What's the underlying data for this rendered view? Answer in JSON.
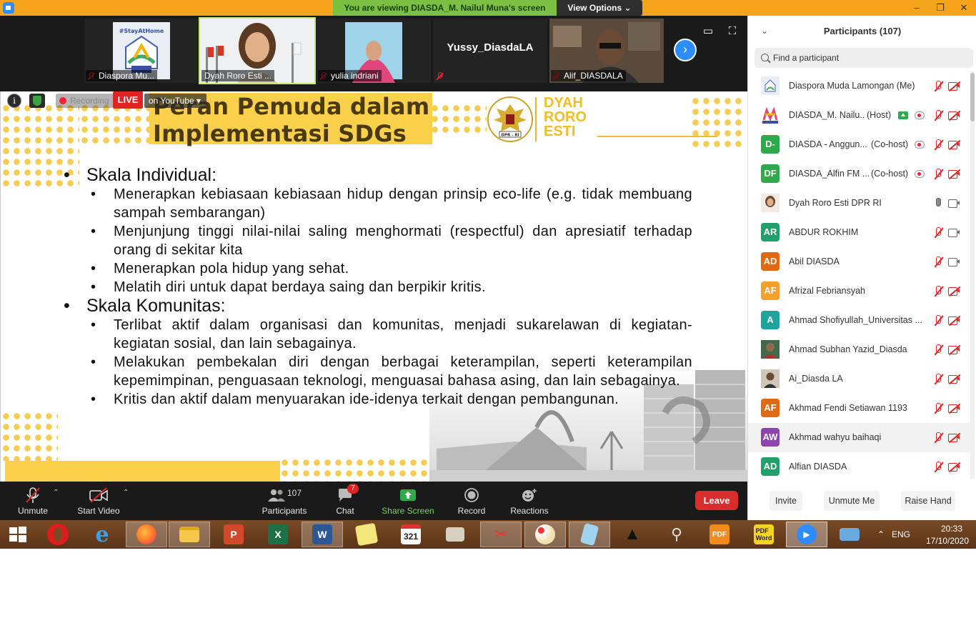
{
  "topbar": {
    "viewing_text": "You are viewing DIASDA_M. Nailul Muna's screen",
    "view_options": "View Options"
  },
  "video_strip": {
    "tiles": [
      {
        "label": "Diaspora Mu..."
      },
      {
        "label": "Dyah Roro Esti ..."
      },
      {
        "label": "yulia indriani"
      },
      {
        "label": "",
        "center_name": "Yussy_DiasdaLA"
      },
      {
        "label": "Alif_DIASDALA"
      }
    ]
  },
  "slide_overlay": {
    "recording": "Recording",
    "live": "LIVE",
    "youtube": "on YouTube"
  },
  "slide": {
    "title_line1": "Peran Pemuda dalam",
    "title_line2": "Implementasi SDGs",
    "brand_line1": "DYAH",
    "brand_line2": "RORO",
    "brand_line3": "ESTI",
    "emblem_text": "DPR - RI",
    "sections": [
      {
        "heading": "Skala Individual:",
        "items": [
          "Menerapkan kebiasaan kebiasaan hidup dengan prinsip eco-life (e.g. tidak membuang sampah sembarangan)",
          "Menjunjung tinggi nilai-nilai saling menghormati (respectful) dan apresiatif terhadap orang di sekitar kita",
          "Menerapkan pola hidup yang sehat.",
          "Melatih diri untuk dapat berdaya  saing dan berpikir kritis."
        ]
      },
      {
        "heading": "Skala Komunitas:",
        "items": [
          "Terlibat aktif dalam organisasi dan komunitas, menjadi sukarelawan di kegiatan-kegiatan sosial, dan lain sebagainya.",
          "Melakukan pembekalan diri dengan berbagai keterampilan, seperti keterampilan kepemimpinan, penguasaan teknologi, menguasai bahasa asing, dan lain sebagainya.",
          "Kritis dan aktif dalam menyuarakan ide-idenya terkait dengan pembangunan."
        ]
      }
    ]
  },
  "toolbar": {
    "unmute": "Unmute",
    "start_video": "Start Video",
    "participants": "Participants",
    "participants_count": "107",
    "chat": "Chat",
    "chat_badge": "7",
    "share_screen": "Share Screen",
    "record": "Record",
    "reactions": "Reactions",
    "leave": "Leave"
  },
  "panel": {
    "title": "Participants (107)",
    "search_placeholder": "Find a participant",
    "participants": [
      {
        "name": "Diaspora Muda Lamongan (Me)",
        "initials": "",
        "color": "#9bb6d6",
        "role": "",
        "mic": "muted",
        "cam": "off"
      },
      {
        "name": "DIASDA_M. Nailu...",
        "initials": "",
        "color": "#ffffff",
        "role": "(Host)",
        "mic": "muted",
        "cam": "off"
      },
      {
        "name": "DIASDA - Anggun...",
        "initials": "D-",
        "color": "#2eaa4a",
        "role": "(Co-host)",
        "mic": "muted",
        "cam": "off"
      },
      {
        "name": "DIASDA_Alfin FM ...",
        "initials": "DF",
        "color": "#2eaa4a",
        "role": "(Co-host)",
        "mic": "muted",
        "cam": "off"
      },
      {
        "name": "Dyah Roro Esti DPR RI",
        "initials": "",
        "color": "#e8d8c8",
        "role": "",
        "mic": "on",
        "cam": "on"
      },
      {
        "name": "ABDUR ROKHIM",
        "initials": "AR",
        "color": "#22a06b",
        "role": "",
        "mic": "muted",
        "cam": "on"
      },
      {
        "name": "Abil DIASDA",
        "initials": "AD",
        "color": "#e06a14",
        "role": "",
        "mic": "muted",
        "cam": "on"
      },
      {
        "name": "Afrizal Febriansyah",
        "initials": "AF",
        "color": "#f2a22c",
        "role": "",
        "mic": "muted",
        "cam": "off"
      },
      {
        "name": "Ahmad Shofiyullah_Universitas ...",
        "initials": "A",
        "color": "#1fa39a",
        "role": "",
        "mic": "muted",
        "cam": "off"
      },
      {
        "name": "Ahmad Subhan Yazid_Diasda",
        "initials": "",
        "color": "#8a6b4e",
        "role": "",
        "mic": "muted",
        "cam": "off"
      },
      {
        "name": "Ai_Diasda LA",
        "initials": "",
        "color": "#6f6a5c",
        "role": "",
        "mic": "muted",
        "cam": "off"
      },
      {
        "name": "Akhmad Fendi Setiawan 1193",
        "initials": "AF",
        "color": "#e06a14",
        "role": "",
        "mic": "muted",
        "cam": "off"
      },
      {
        "name": "Akhmad wahyu baihaqi",
        "initials": "AW",
        "color": "#8e44ad",
        "role": "",
        "mic": "muted",
        "cam": "off"
      },
      {
        "name": "Alfian DIASDA",
        "initials": "AD",
        "color": "#22a06b",
        "role": "",
        "mic": "muted",
        "cam": "off"
      }
    ],
    "invite": "Invite",
    "unmute_me": "Unmute Me",
    "raise_hand": "Raise Hand"
  },
  "taskbar": {
    "language": "ENG",
    "time": "20:33",
    "date": "17/10/2020"
  }
}
